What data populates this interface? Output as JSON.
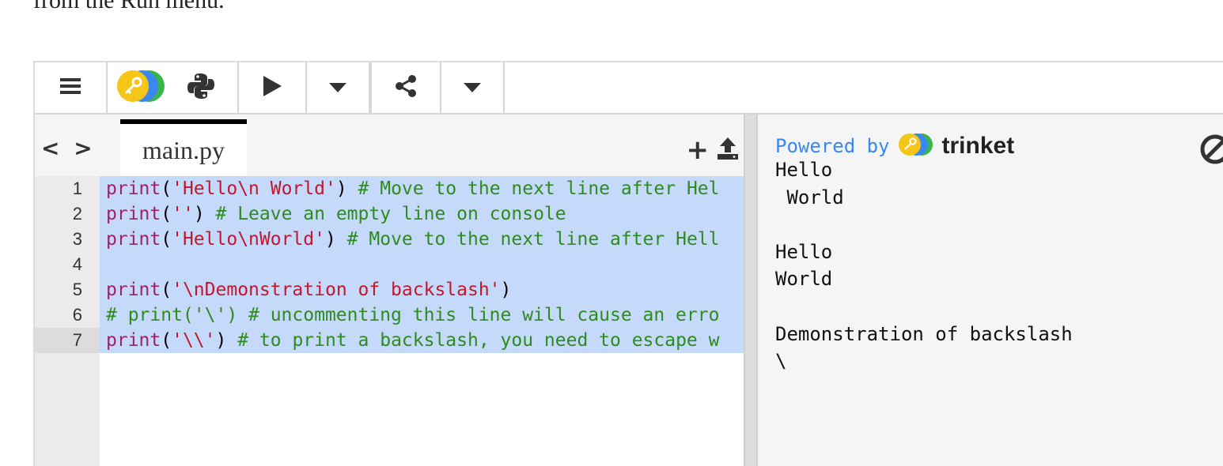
{
  "intro_text": "from the Run menu.",
  "toolbar": {
    "menu_icon": "hamburger-icon",
    "logo_icon": "trinket-key-logo",
    "python_icon": "python-icon",
    "run_icon": "play-icon",
    "run_dropdown_icon": "caret-down-icon",
    "share_icon": "share-icon",
    "share_dropdown_icon": "caret-down-icon"
  },
  "editor": {
    "nav_label": "< >",
    "file_tab": "main.py",
    "add_file_label": "+",
    "upload_icon": "upload-icon",
    "line_numbers": [
      "1",
      "2",
      "3",
      "4",
      "5",
      "6",
      "7"
    ],
    "active_line": "7",
    "code_lines": [
      [
        {
          "t": "print",
          "c": "kw"
        },
        {
          "t": "(",
          "c": ""
        },
        {
          "t": "'Hello\\n World'",
          "c": "str"
        },
        {
          "t": ") ",
          "c": ""
        },
        {
          "t": "# Move to the next line after Hel",
          "c": "cm"
        }
      ],
      [
        {
          "t": "print",
          "c": "kw"
        },
        {
          "t": "(",
          "c": ""
        },
        {
          "t": "''",
          "c": "str"
        },
        {
          "t": ") ",
          "c": ""
        },
        {
          "t": "# Leave an empty line on console",
          "c": "cm"
        }
      ],
      [
        {
          "t": "print",
          "c": "kw"
        },
        {
          "t": "(",
          "c": ""
        },
        {
          "t": "'Hello\\nWorld'",
          "c": "str"
        },
        {
          "t": ") ",
          "c": ""
        },
        {
          "t": "# Move to the next line after Hell",
          "c": "cm"
        }
      ],
      [],
      [
        {
          "t": "print",
          "c": "kw"
        },
        {
          "t": "(",
          "c": ""
        },
        {
          "t": "'\\nDemonstration of backslash'",
          "c": "str"
        },
        {
          "t": ")",
          "c": ""
        }
      ],
      [
        {
          "t": "# print('\\') # uncommenting this line will cause an erro",
          "c": "cm"
        }
      ],
      [
        {
          "t": "print",
          "c": "kw"
        },
        {
          "t": "(",
          "c": ""
        },
        {
          "t": "'\\\\'",
          "c": "str"
        },
        {
          "t": ") ",
          "c": ""
        },
        {
          "t": "# to print a backslash, you need to escape w",
          "c": "cm"
        }
      ]
    ]
  },
  "output": {
    "powered_by": "Powered by",
    "brand": "trinket",
    "clear_icon": "clear-output-icon",
    "lines": [
      "Hello",
      " World",
      "",
      "Hello",
      "World",
      "",
      "Demonstration of backslash",
      "\\"
    ]
  },
  "colors": {
    "selection": "#c5d9fa",
    "keyword": "#a0206a",
    "string": "#c0182f",
    "comment": "#2e8b20",
    "powered_by": "#3a87f0",
    "logo_yellow": "#f5c518",
    "logo_blue": "#3a87f0",
    "logo_green": "#39b54a"
  }
}
